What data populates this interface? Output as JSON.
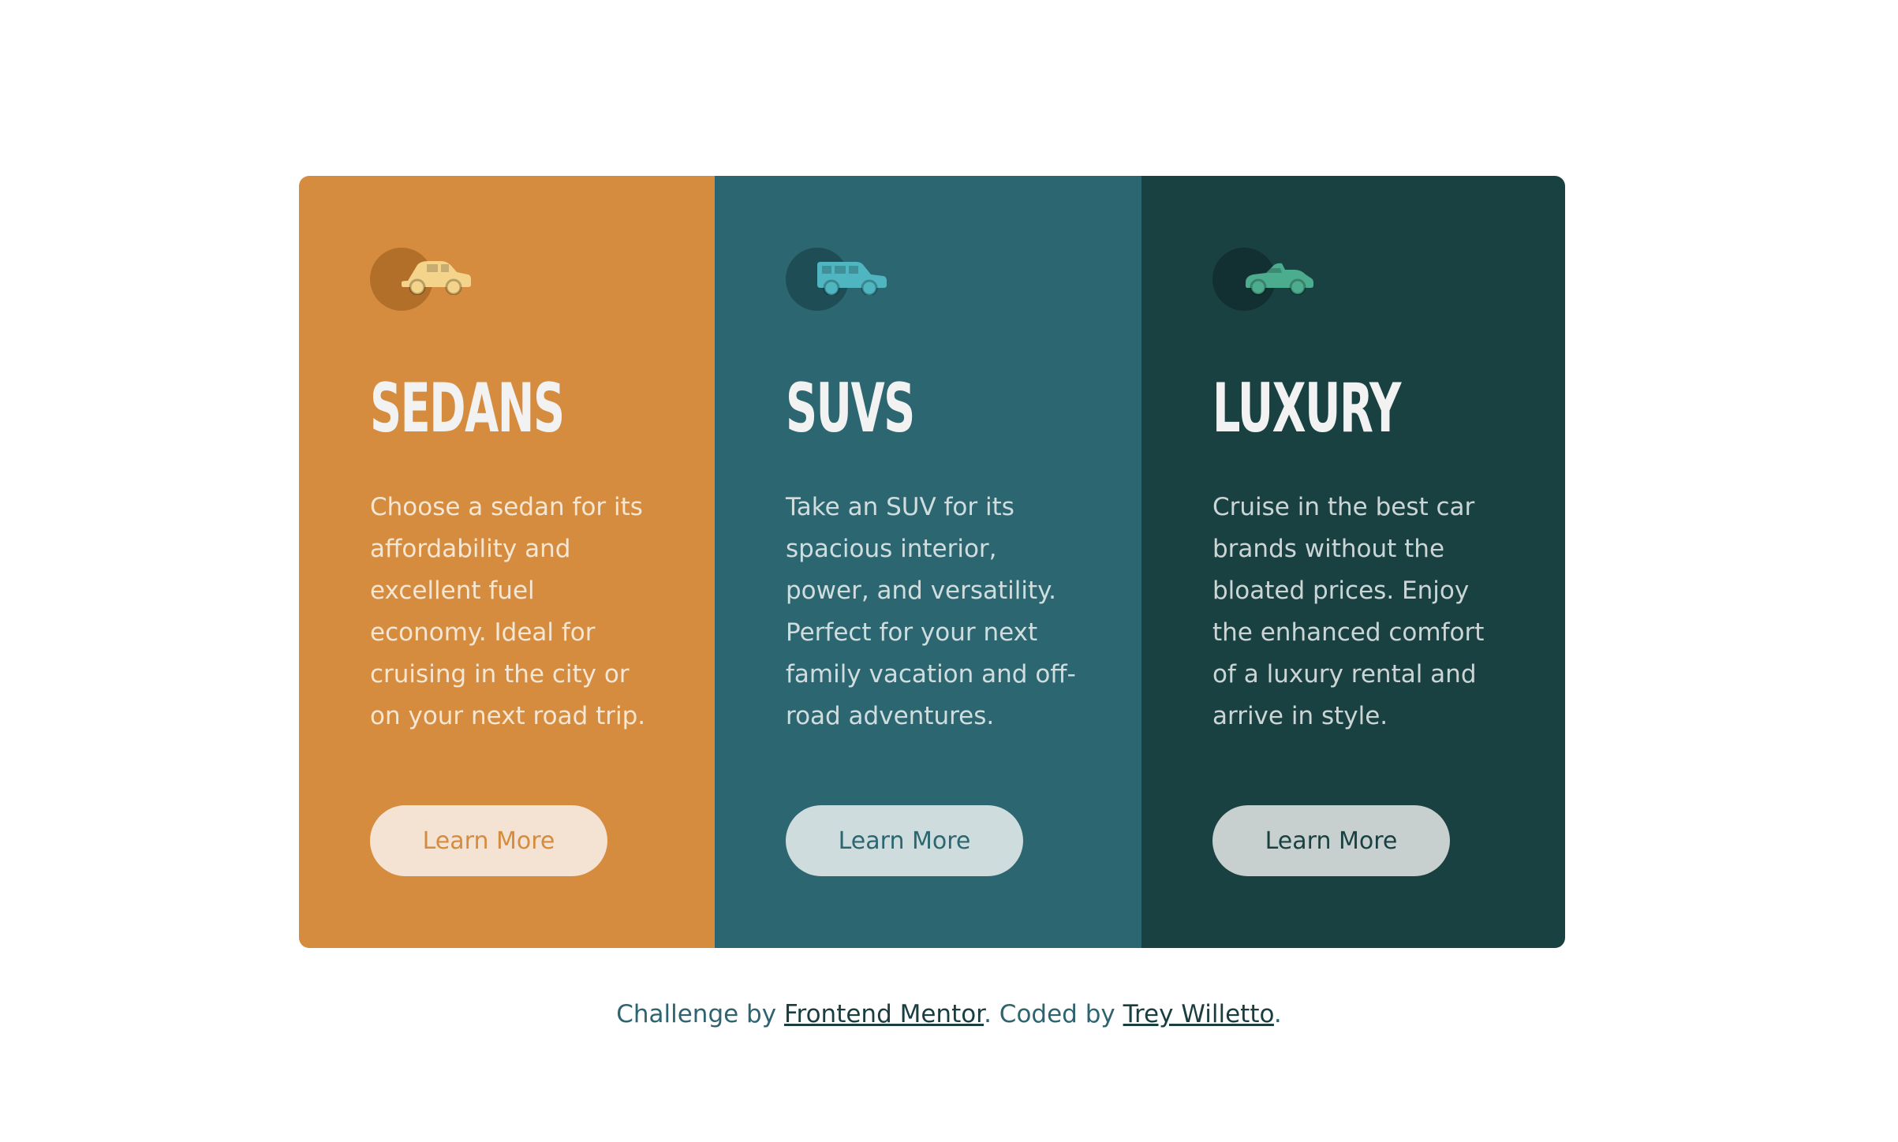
{
  "cards": [
    {
      "id": "sedans",
      "icon": "sedan-car-icon",
      "title": "SEDANS",
      "description": "Choose a sedan for its affordability and excellent fuel economy. Ideal for cruising in the city or on your next road trip.",
      "button_label": "Learn More",
      "colors": {
        "background": "#d58c3e",
        "icon_circle": "#b16f2a",
        "icon": "#f3d48a",
        "button_bg": "#f4e2d2",
        "button_text": "#d58c3e"
      }
    },
    {
      "id": "suvs",
      "icon": "suv-car-icon",
      "title": "SUVS",
      "description": "Take an SUV for its spacious interior, power, and versatility. Perfect for your next family vacation and off-road adventures.",
      "button_label": "Learn More",
      "colors": {
        "background": "#2c6670",
        "icon_circle": "#1e4d55",
        "icon": "#4fb5c0",
        "button_bg": "#cedcde",
        "button_text": "#2c6670"
      }
    },
    {
      "id": "luxury",
      "icon": "luxury-car-icon",
      "title": "LUXURY",
      "description": "Cruise in the best car brands without the bloated prices. Enjoy the enhanced comfort of a luxury rental and arrive in style.",
      "button_label": "Learn More",
      "colors": {
        "background": "#1a4142",
        "icon_circle": "#122f31",
        "icon": "#4cad8e",
        "button_bg": "#c7d0cf",
        "button_text": "#1a4142"
      }
    }
  ],
  "footer": {
    "prefix": "Challenge by ",
    "link1": "Frontend Mentor",
    "middle": ". Coded by ",
    "link2": "Trey Willetto",
    "suffix": "."
  }
}
